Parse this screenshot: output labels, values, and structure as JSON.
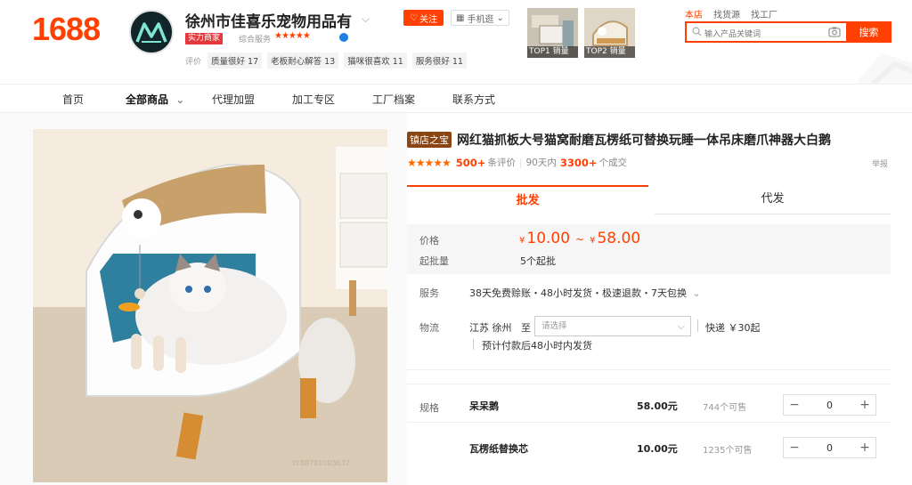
{
  "header": {
    "logo": "1688",
    "shop_name": "徐州市佳喜乐宠物用品有",
    "follow": "关注",
    "mobile": "手机逛",
    "merchant_badge": "实力商家",
    "service_label": "综合服务",
    "service_stars": "★★★★★",
    "rating_label": "评价",
    "tags": [
      "质量很好 17",
      "老板耐心解答 13",
      "猫咪很喜欢 11",
      "服务很好 11"
    ],
    "top_products": [
      "TOP1 销量",
      "TOP2 销量"
    ],
    "search_tabs": [
      "本店",
      "找货源",
      "找工厂"
    ],
    "search_placeholder": "输入产品关键词",
    "search_button": "搜索"
  },
  "nav": {
    "items": [
      "首页",
      "全部商品",
      "代理加盟",
      "加工专区",
      "工厂档案",
      "联系方式"
    ]
  },
  "product": {
    "badge": "镇店之宝",
    "title": "网红猫抓板大号猫窝耐磨瓦楞纸可替换玩睡一体吊床磨爪神器大白鹅",
    "stars": "★★★★★",
    "reviews_count": "500+",
    "reviews_label": "条评价",
    "deals_period": "90天内",
    "deals_count": "3300+",
    "deals_label": "个成交",
    "report": "举报",
    "watermark": "YE88781003637"
  },
  "tabs": {
    "wholesale": "批发",
    "dropship": "代发"
  },
  "price": {
    "label": "价格",
    "currency": "¥",
    "min": "10.00",
    "tilde": "~",
    "max": "58.00",
    "moq_label": "起批量",
    "moq_value": "5个起批"
  },
  "service": {
    "label": "服务",
    "value": "38天免费赊账・48小时发货・极速退款・7天包换"
  },
  "logistics": {
    "label": "物流",
    "origin": "江苏 徐州",
    "to": "至",
    "select_placeholder": "请选择",
    "express": "快递 ￥30起",
    "dispatch": "预计付款后48小时内发货"
  },
  "specs": {
    "label": "规格",
    "items": [
      {
        "name": "呆呆鹅",
        "price": "58.00元",
        "stock": "744个可售",
        "qty": "0"
      },
      {
        "name": "瓦楞纸替换芯",
        "price": "10.00元",
        "stock": "1235个可售",
        "qty": "0"
      }
    ]
  },
  "colors": {
    "accent": "#ff4000",
    "zhen_badge": "#8b4513"
  }
}
